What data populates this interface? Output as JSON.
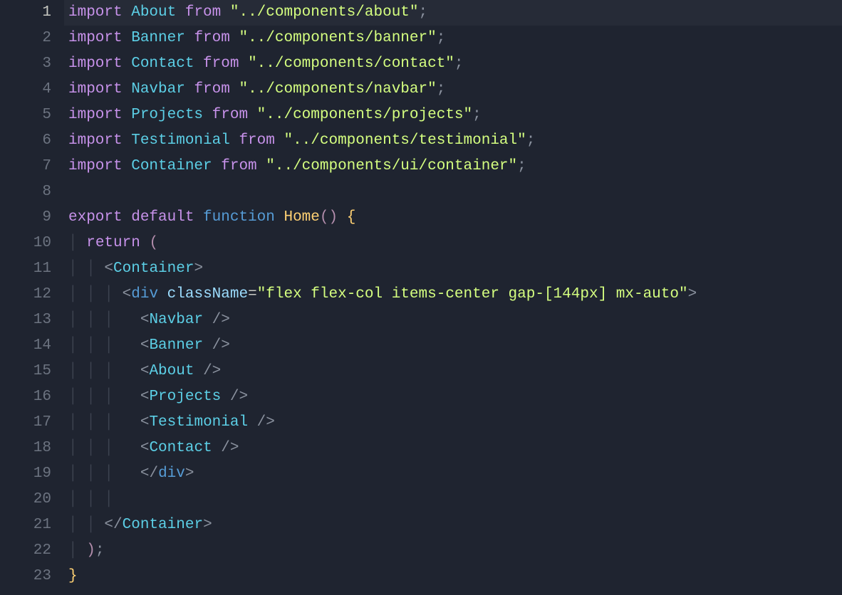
{
  "editor": {
    "activeLine": 1,
    "lineNumbers": [
      "1",
      "2",
      "3",
      "4",
      "5",
      "6",
      "7",
      "8",
      "9",
      "10",
      "11",
      "12",
      "13",
      "14",
      "15",
      "16",
      "17",
      "18",
      "19",
      "20",
      "21",
      "22",
      "23"
    ],
    "lines": [
      {
        "tokens": [
          {
            "t": "import ",
            "c": "kw-import"
          },
          {
            "t": "About",
            "c": "ident-comp"
          },
          {
            "t": " from ",
            "c": "kw-import"
          },
          {
            "t": "\"../components/about\"",
            "c": "str"
          },
          {
            "t": ";",
            "c": "semi"
          }
        ]
      },
      {
        "tokens": [
          {
            "t": "import ",
            "c": "kw-import"
          },
          {
            "t": "Banner",
            "c": "ident-comp"
          },
          {
            "t": " from ",
            "c": "kw-import"
          },
          {
            "t": "\"../components/banner\"",
            "c": "str"
          },
          {
            "t": ";",
            "c": "semi"
          }
        ]
      },
      {
        "tokens": [
          {
            "t": "import ",
            "c": "kw-import"
          },
          {
            "t": "Contact",
            "c": "ident-comp"
          },
          {
            "t": " from ",
            "c": "kw-import"
          },
          {
            "t": "\"../components/contact\"",
            "c": "str"
          },
          {
            "t": ";",
            "c": "semi"
          }
        ]
      },
      {
        "tokens": [
          {
            "t": "import ",
            "c": "kw-import"
          },
          {
            "t": "Navbar",
            "c": "ident-comp"
          },
          {
            "t": " from ",
            "c": "kw-import"
          },
          {
            "t": "\"../components/navbar\"",
            "c": "str"
          },
          {
            "t": ";",
            "c": "semi"
          }
        ]
      },
      {
        "tokens": [
          {
            "t": "import ",
            "c": "kw-import"
          },
          {
            "t": "Projects",
            "c": "ident-comp"
          },
          {
            "t": " from ",
            "c": "kw-import"
          },
          {
            "t": "\"../components/projects\"",
            "c": "str"
          },
          {
            "t": ";",
            "c": "semi"
          }
        ]
      },
      {
        "tokens": [
          {
            "t": "import ",
            "c": "kw-import"
          },
          {
            "t": "Testimonial",
            "c": "ident-comp"
          },
          {
            "t": " from ",
            "c": "kw-import"
          },
          {
            "t": "\"../components/testimonial\"",
            "c": "str"
          },
          {
            "t": ";",
            "c": "semi"
          }
        ]
      },
      {
        "tokens": [
          {
            "t": "import ",
            "c": "kw-import"
          },
          {
            "t": "Container",
            "c": "ident-comp"
          },
          {
            "t": " from ",
            "c": "kw-import"
          },
          {
            "t": "\"../components/ui/container\"",
            "c": "str"
          },
          {
            "t": ";",
            "c": "semi"
          }
        ]
      },
      {
        "tokens": [
          {
            "t": "",
            "c": "punct"
          }
        ]
      },
      {
        "tokens": [
          {
            "t": "export ",
            "c": "kw-import"
          },
          {
            "t": "default ",
            "c": "kw-import"
          },
          {
            "t": "function ",
            "c": "kw-func"
          },
          {
            "t": "Home",
            "c": "ident-func"
          },
          {
            "t": "()",
            "c": "paren"
          },
          {
            "t": " ",
            "c": "punct"
          },
          {
            "t": "{",
            "c": "brace"
          }
        ]
      },
      {
        "tokens": [
          {
            "t": "│ ",
            "c": "guide"
          },
          {
            "t": "return ",
            "c": "kw-import"
          },
          {
            "t": "(",
            "c": "paren"
          }
        ]
      },
      {
        "tokens": [
          {
            "t": "│ │ ",
            "c": "guide"
          },
          {
            "t": "<",
            "c": "tag-angle"
          },
          {
            "t": "Container",
            "c": "tag-name"
          },
          {
            "t": ">",
            "c": "tag-angle"
          }
        ]
      },
      {
        "tokens": [
          {
            "t": "│ │ │ ",
            "c": "guide"
          },
          {
            "t": "<",
            "c": "tag-angle"
          },
          {
            "t": "div",
            "c": "tag-html"
          },
          {
            "t": " ",
            "c": "punct"
          },
          {
            "t": "className",
            "c": "attr-name"
          },
          {
            "t": "=",
            "c": "attr-eq"
          },
          {
            "t": "\"flex flex-col items-center gap-[144px] mx-auto\"",
            "c": "attr-val"
          },
          {
            "t": ">",
            "c": "tag-angle"
          }
        ]
      },
      {
        "tokens": [
          {
            "t": "│ │ │ ",
            "c": "guide"
          },
          {
            "t": "  ",
            "c": "punct"
          },
          {
            "t": "<",
            "c": "tag-angle"
          },
          {
            "t": "Navbar",
            "c": "tag-name"
          },
          {
            "t": " />",
            "c": "tag-angle"
          }
        ]
      },
      {
        "tokens": [
          {
            "t": "│ │ │ ",
            "c": "guide"
          },
          {
            "t": "  ",
            "c": "punct"
          },
          {
            "t": "<",
            "c": "tag-angle"
          },
          {
            "t": "Banner",
            "c": "tag-name"
          },
          {
            "t": " />",
            "c": "tag-angle"
          }
        ]
      },
      {
        "tokens": [
          {
            "t": "│ │ │ ",
            "c": "guide"
          },
          {
            "t": "  ",
            "c": "punct"
          },
          {
            "t": "<",
            "c": "tag-angle"
          },
          {
            "t": "About",
            "c": "tag-name"
          },
          {
            "t": " />",
            "c": "tag-angle"
          }
        ]
      },
      {
        "tokens": [
          {
            "t": "│ │ │ ",
            "c": "guide"
          },
          {
            "t": "  ",
            "c": "punct"
          },
          {
            "t": "<",
            "c": "tag-angle"
          },
          {
            "t": "Projects",
            "c": "tag-name"
          },
          {
            "t": " />",
            "c": "tag-angle"
          }
        ]
      },
      {
        "tokens": [
          {
            "t": "│ │ │ ",
            "c": "guide"
          },
          {
            "t": "  ",
            "c": "punct"
          },
          {
            "t": "<",
            "c": "tag-angle"
          },
          {
            "t": "Testimonial",
            "c": "tag-name"
          },
          {
            "t": " />",
            "c": "tag-angle"
          }
        ]
      },
      {
        "tokens": [
          {
            "t": "│ │ │ ",
            "c": "guide"
          },
          {
            "t": "  ",
            "c": "punct"
          },
          {
            "t": "<",
            "c": "tag-angle"
          },
          {
            "t": "Contact",
            "c": "tag-name"
          },
          {
            "t": " />",
            "c": "tag-angle"
          }
        ]
      },
      {
        "tokens": [
          {
            "t": "│ │ │ ",
            "c": "guide"
          },
          {
            "t": "  ",
            "c": "punct"
          },
          {
            "t": "</",
            "c": "tag-angle"
          },
          {
            "t": "div",
            "c": "tag-html"
          },
          {
            "t": ">",
            "c": "tag-angle"
          }
        ]
      },
      {
        "tokens": [
          {
            "t": "│ │ │",
            "c": "guide"
          }
        ]
      },
      {
        "tokens": [
          {
            "t": "│ │ ",
            "c": "guide"
          },
          {
            "t": "</",
            "c": "tag-angle"
          },
          {
            "t": "Container",
            "c": "tag-name"
          },
          {
            "t": ">",
            "c": "tag-angle"
          }
        ]
      },
      {
        "tokens": [
          {
            "t": "│ ",
            "c": "guide"
          },
          {
            "t": ")",
            "c": "paren"
          },
          {
            "t": ";",
            "c": "semi"
          }
        ]
      },
      {
        "tokens": [
          {
            "t": "}",
            "c": "brace"
          }
        ]
      }
    ]
  }
}
